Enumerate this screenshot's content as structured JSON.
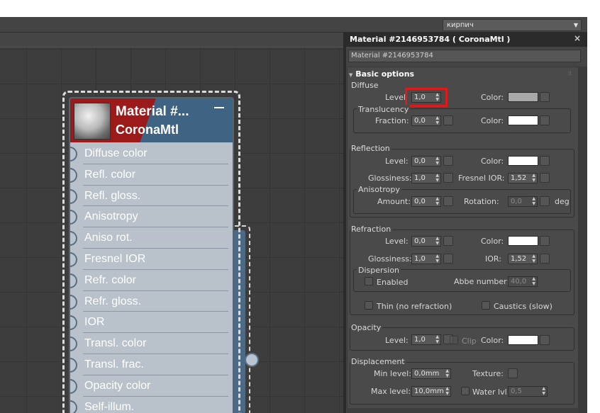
{
  "top": {
    "dropdown_value": "кирпич"
  },
  "node": {
    "title_line1": "Material #...",
    "title_line2": "CoronaMtl",
    "slots": [
      "Diffuse color",
      "Refl. color",
      "Refl. gloss.",
      "Anisotropy",
      "Aniso rot.",
      "Fresnel IOR",
      "Refr. color",
      "Refr. gloss.",
      "IOR",
      "Transl. color",
      "Transl. frac.",
      "Opacity color",
      "Self-illum."
    ]
  },
  "panel": {
    "title": "Material #2146953784  ( CoronaMtl )",
    "close": "×",
    "name_value": "Material #2146953784",
    "rollout_title": "Basic options",
    "diffuse": {
      "section": "Diffuse",
      "level_label": "Level",
      "level_value": "1,0",
      "color_label": "Color:",
      "color": "#a8a8a8",
      "translucency": "Translucency",
      "fraction_label": "Fraction:",
      "fraction_value": "0,0",
      "tcolor_label": "Color:",
      "tcolor": "#ffffff"
    },
    "reflection": {
      "section": "Reflection",
      "level_label": "Level:",
      "level_value": "0,0",
      "color_label": "Color:",
      "color": "#ffffff",
      "gloss_label": "Glossiness:",
      "gloss_value": "1,0",
      "fresnel_label": "Fresnel IOR:",
      "fresnel_value": "1,52",
      "anisotropy": "Anisotropy",
      "amount_label": "Amount:",
      "amount_value": "0,0",
      "rotation_label": "Rotation:",
      "rotation_value": "0,0",
      "deg": "deg"
    },
    "refraction": {
      "section": "Refraction",
      "level_label": "Level:",
      "level_value": "0,0",
      "color_label": "Color:",
      "color": "#ffffff",
      "gloss_label": "Glossiness:",
      "gloss_value": "1,0",
      "ior_label": "IOR:",
      "ior_value": "1,52",
      "dispersion": "Dispersion",
      "enabled_label": "Enabled",
      "abbe_label": "Abbe number:",
      "abbe_value": "40,0",
      "thin_label": "Thin (no refraction)",
      "caustics_label": "Caustics (slow)"
    },
    "opacity": {
      "section": "Opacity",
      "level_label": "Level:",
      "level_value": "1,0",
      "clip_label": "Clip",
      "color_label": "Color:",
      "color": "#ffffff"
    },
    "displacement": {
      "section": "Displacement",
      "min_label": "Min level:",
      "min_value": "0,0mm",
      "texture_label": "Texture:",
      "max_label": "Max level:",
      "max_value": "10,0mm",
      "water_label": "Water lvl.",
      "water_value": "0,5"
    }
  }
}
